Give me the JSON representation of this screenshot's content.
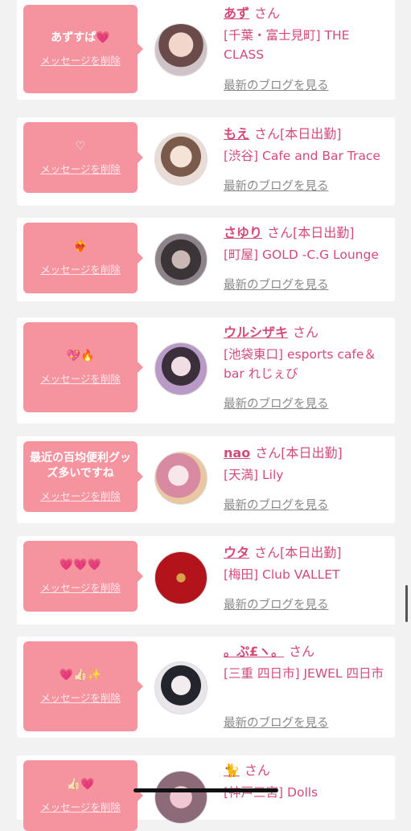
{
  "delete_label": "メッセージを削除",
  "blog_label": "最新のブログを見る",
  "san": "さん",
  "items": [
    {
      "message": "あずすぱ💗",
      "name": "あず",
      "status": "",
      "shop": "[千葉・富士見町] THE CLASS"
    },
    {
      "message": "♡",
      "name": "もえ",
      "status": "[本日出勤]",
      "shop": "[渋谷] Cafe and Bar Trace"
    },
    {
      "message": "❤️‍🔥",
      "name": "さゆり",
      "status": "[本日出勤]",
      "shop": "[町屋] GOLD -C.G Lounge"
    },
    {
      "message": "💖🔥",
      "name": "ウルシザキ",
      "status": "",
      "shop": "[池袋東口] esports cafe＆bar れじぇび"
    },
    {
      "message": "最近の百均便利グッズ多いですね",
      "name": "nao",
      "status": "[本日出勤]",
      "shop": "[天満] Lily"
    },
    {
      "message": "💗💗💗",
      "name": "ウタ",
      "status": "[本日出勤]",
      "shop": "[梅田] Club VALLET"
    },
    {
      "message": "💗👍🏻✨",
      "name": "。ぷ£ヽ。",
      "status": "",
      "shop": "[三重 四日市] JEWEL 四日市"
    },
    {
      "message": "👍🏻💗",
      "name": "🐈",
      "status": "",
      "shop": "[神戸三宮] Dolls"
    }
  ],
  "colors": {
    "accent": "#f5939f",
    "name": "#d44a77",
    "bg": "#f2f2f2"
  }
}
